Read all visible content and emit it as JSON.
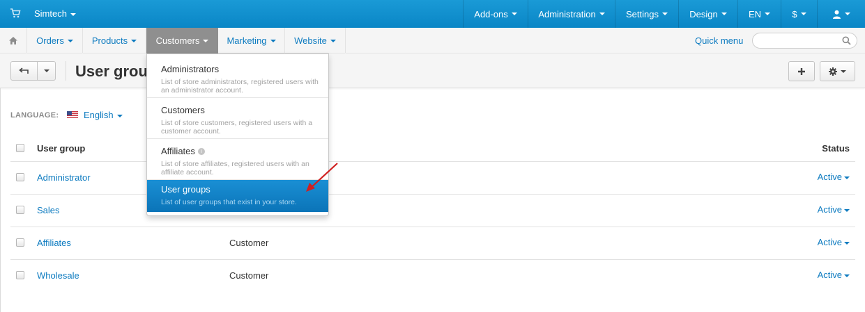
{
  "topbar": {
    "store": "Simtech",
    "menu": [
      "Add-ons",
      "Administration",
      "Settings",
      "Design",
      "EN",
      "$"
    ]
  },
  "subnav": {
    "items": [
      "Orders",
      "Products",
      "Customers",
      "Marketing",
      "Website"
    ],
    "active": "Customers",
    "quick_menu": "Quick menu",
    "search_placeholder": ""
  },
  "page": {
    "title": "User groups"
  },
  "language": {
    "label": "LANGUAGE:",
    "value": "English"
  },
  "table": {
    "headers": {
      "group": "User group",
      "status": "Status"
    },
    "rows": [
      {
        "name": "Administrator",
        "type": "",
        "status": "Active"
      },
      {
        "name": "Sales",
        "type": "",
        "status": "Active"
      },
      {
        "name": "Affiliates",
        "type": "Customer",
        "status": "Active"
      },
      {
        "name": "Wholesale",
        "type": "Customer",
        "status": "Active"
      }
    ]
  },
  "customers_menu": {
    "items": [
      {
        "title": "Administrators",
        "desc": "List of store administrators, registered users with an administrator account."
      },
      {
        "title": "Customers",
        "desc": "List of store customers, registered users with a customer account."
      },
      {
        "title": "Affiliates",
        "desc": "List of store affiliates, registered users with an affiliate account."
      },
      {
        "title": "User groups",
        "desc": "List of user groups that exist in your store."
      }
    ],
    "selected": "User groups"
  },
  "colors": {
    "topbar": "#0a86c6",
    "link": "#0d7bc0",
    "active_tab": "#8f8f8f",
    "selected_item": "#0b74b8",
    "annotation_arrow": "#d02020"
  }
}
